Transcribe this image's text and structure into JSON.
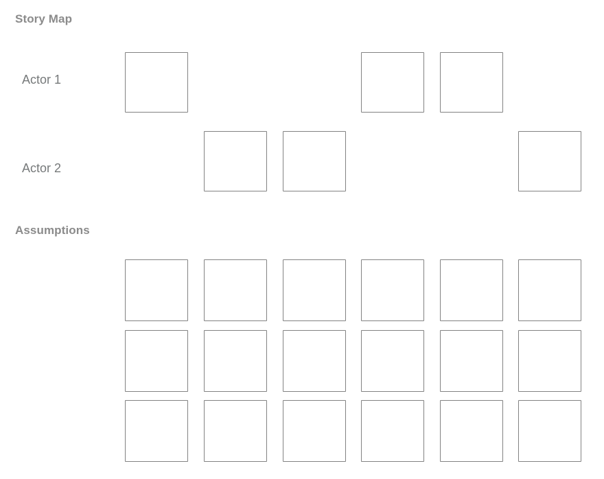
{
  "sections": {
    "story_map": {
      "title": "Story Map",
      "rows": [
        {
          "label": "Actor 1",
          "filled_columns": [
            1,
            4,
            5
          ]
        },
        {
          "label": "Actor 2",
          "filled_columns": [
            2,
            3,
            6
          ]
        }
      ]
    },
    "assumptions": {
      "title": "Assumptions",
      "grid": {
        "columns": 6,
        "rows": 3,
        "all_filled": true
      }
    }
  },
  "colors": {
    "background": "#ffffff",
    "card_border": "#828282",
    "card_fill": "#ffffff",
    "section_title": "#8b8b8b",
    "row_label": "#76797a"
  }
}
